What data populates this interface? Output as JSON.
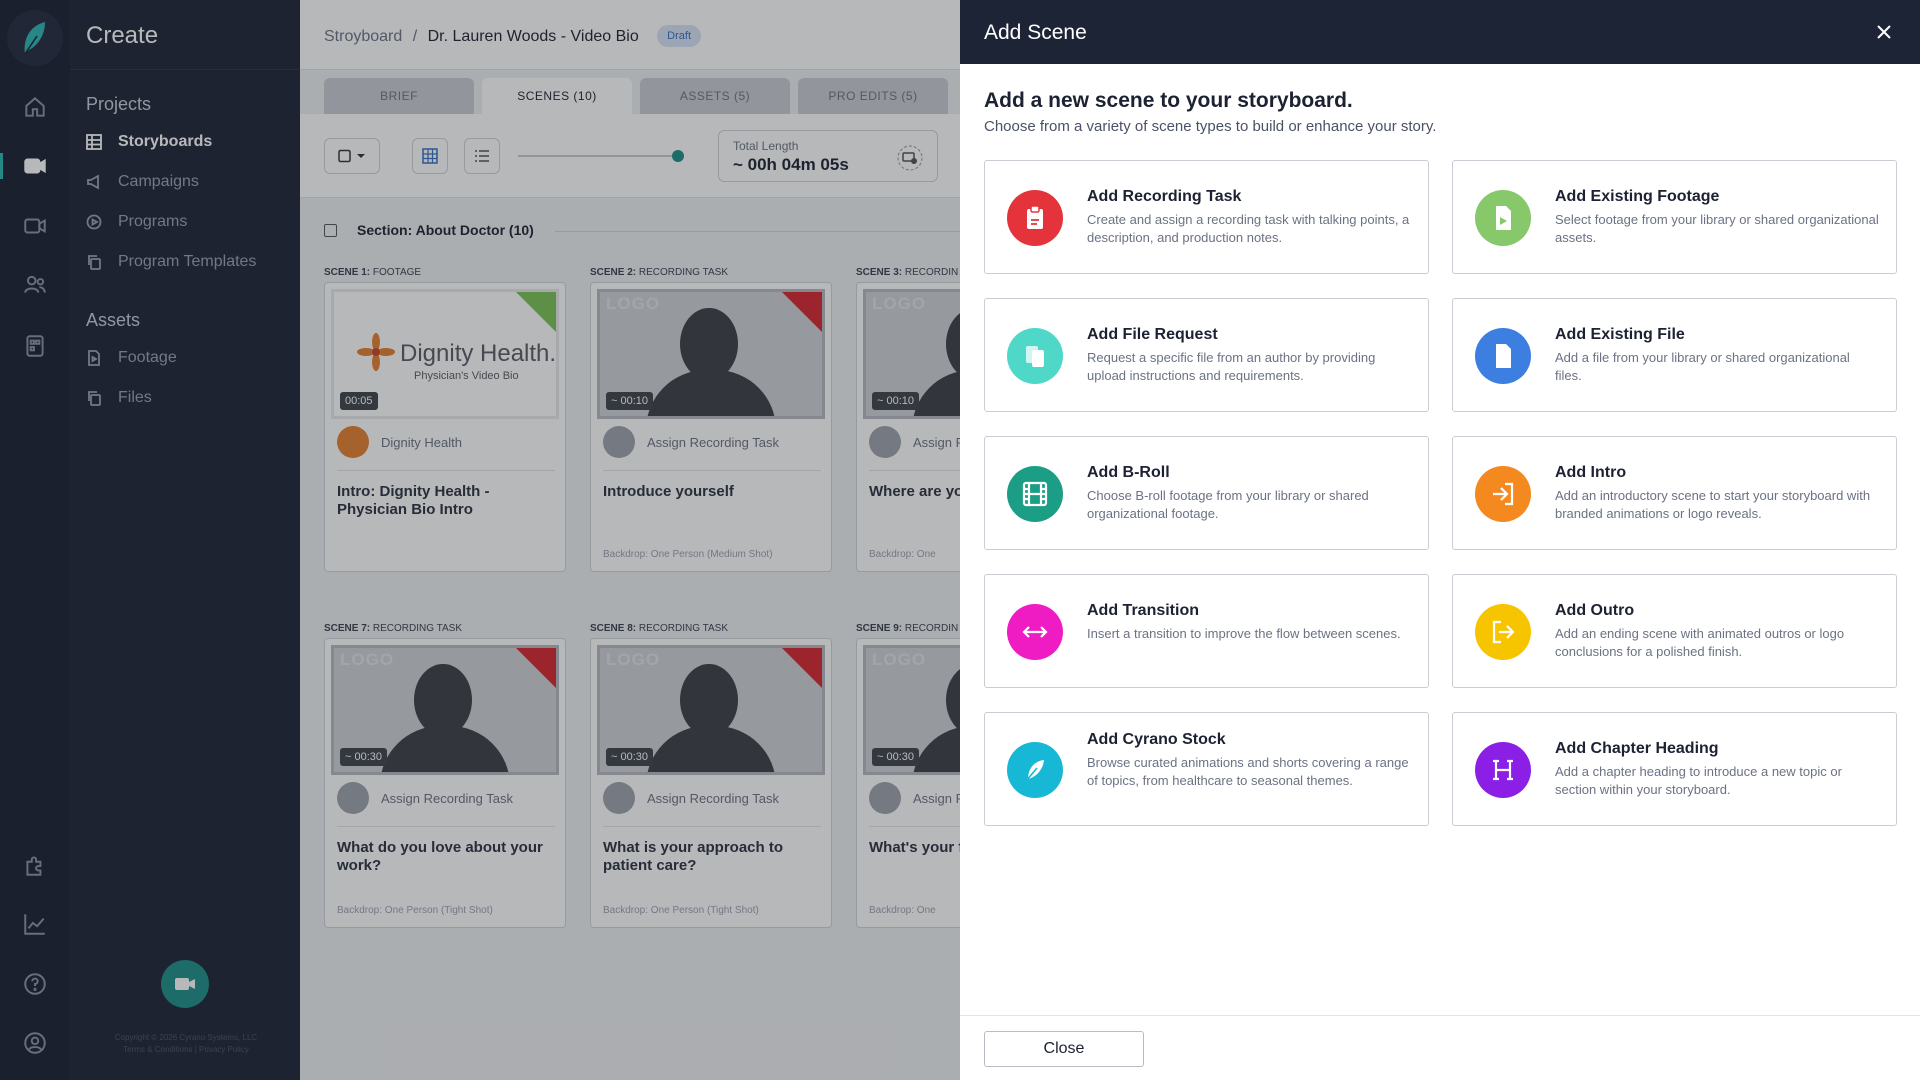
{
  "app": {
    "section_title": "Create"
  },
  "nav": {
    "projects_heading": "Projects",
    "projects": [
      "Storyboards",
      "Campaigns",
      "Programs",
      "Program Templates"
    ],
    "assets_heading": "Assets",
    "assets": [
      "Footage",
      "Files"
    ],
    "footer_copyright": "Copyright © 2026 Cyrano Systems, LLC",
    "footer_links": "Terms & Conditions | Privacy Policy"
  },
  "breadcrumb": {
    "root": "Stroyboard",
    "separator": "/",
    "current": "Dr. Lauren Woods  - Video Bio",
    "status": "Draft"
  },
  "tabs": [
    "BRIEF",
    "SCENES (10)",
    "ASSETS (5)",
    "PRO EDITS (5)"
  ],
  "toolbar": {
    "total_label": "Total Length",
    "total_value": "~ 00h 04m 05s",
    "zoom_level": 1.0
  },
  "section": {
    "label": "Section: About Doctor (10)"
  },
  "scenes": [
    {
      "num": "SCENE 1:",
      "type": "FOOTAGE",
      "duration": "00:05",
      "assignee": "Dignity Health",
      "title": "Intro: Dignity Health - Physician Bio Intro",
      "backdrop": "",
      "thumb_logo": "LOGO",
      "brand_name": "Dignity Health.",
      "brand_sub": "Physician's Video Bio"
    },
    {
      "num": "SCENE 2:",
      "type": "RECORDING TASK",
      "duration": "~ 00:10",
      "assignee": "Assign Recording Task",
      "title": "Introduce yourself",
      "backdrop": "Backdrop: One Person (Medium Shot)",
      "thumb_logo": "LOGO"
    },
    {
      "num": "SCENE 3:",
      "type": "RECORDIN",
      "duration": "~ 00:10",
      "assignee": "Assign R",
      "title": "Where are yo",
      "backdrop": "Backdrop: One",
      "thumb_logo": "LOGO"
    },
    {
      "num": "SCENE 7:",
      "type": "RECORDING TASK",
      "duration": "~ 00:30",
      "assignee": "Assign Recording Task",
      "title": "What do you love about your work?",
      "backdrop": "Backdrop: One Person (Tight Shot)",
      "thumb_logo": "LOGO"
    },
    {
      "num": "SCENE 8:",
      "type": "RECORDING TASK",
      "duration": "~ 00:30",
      "assignee": "Assign Recording Task",
      "title": "What is your approach to patient care?",
      "backdrop": "Backdrop: One Person (Tight Shot)",
      "thumb_logo": "LOGO"
    },
    {
      "num": "SCENE 9:",
      "type": "RECORDIN",
      "duration": "~ 00:30",
      "assignee": "Assign R",
      "title": "What's your f of work?",
      "backdrop": "Backdrop: One",
      "thumb_logo": "LOGO"
    }
  ],
  "panel": {
    "title": "Add Scene",
    "heading": "Add a new scene to your storyboard.",
    "subheading": "Choose from a variety of scene types to build or enhance your story.",
    "close_label": "Close",
    "options": [
      {
        "title": "Add Recording Task",
        "desc": "Create and assign a recording task with talking points, a description, and production notes.",
        "icon": "clipboard-icon",
        "color": "#e5333b"
      },
      {
        "title": "Add Existing Footage",
        "desc": "Select footage from your library or shared organizational assets.",
        "icon": "video-file-icon",
        "color": "#86c86a"
      },
      {
        "title": "Add File Request",
        "desc": "Request a specific file from an author by providing upload instructions and requirements.",
        "icon": "file-request-icon",
        "color": "#4fd8c7"
      },
      {
        "title": "Add Existing File",
        "desc": "Add a file from your library or shared organizational files.",
        "icon": "file-icon",
        "color": "#3d7fe0"
      },
      {
        "title": "Add B-Roll",
        "desc": "Choose B-roll footage from your library or shared organizational footage.",
        "icon": "film-icon",
        "color": "#1b9e85"
      },
      {
        "title": "Add Intro",
        "desc": "Add an introductory scene to start your storyboard with branded animations or logo reveals.",
        "icon": "sign-in-icon",
        "color": "#f48a1f"
      },
      {
        "title": "Add Transition",
        "desc": "Insert a transition to improve the flow between scenes.",
        "icon": "arrows-horizontal-icon",
        "color": "#ee1cc2"
      },
      {
        "title": "Add Outro",
        "desc": "Add an ending scene with animated outros or logo conclusions for a polished finish.",
        "icon": "sign-out-icon",
        "color": "#f7c400"
      },
      {
        "title": "Add Cyrano Stock",
        "desc": "Browse curated animations and shorts covering a range of topics, from healthcare to seasonal themes.",
        "icon": "feather-icon",
        "color": "#17b8d5"
      },
      {
        "title": "Add Chapter Heading",
        "desc": "Add a chapter heading to introduce a new topic or section within your storyboard.",
        "icon": "heading-h-icon",
        "color": "#8b1fe6"
      }
    ]
  }
}
